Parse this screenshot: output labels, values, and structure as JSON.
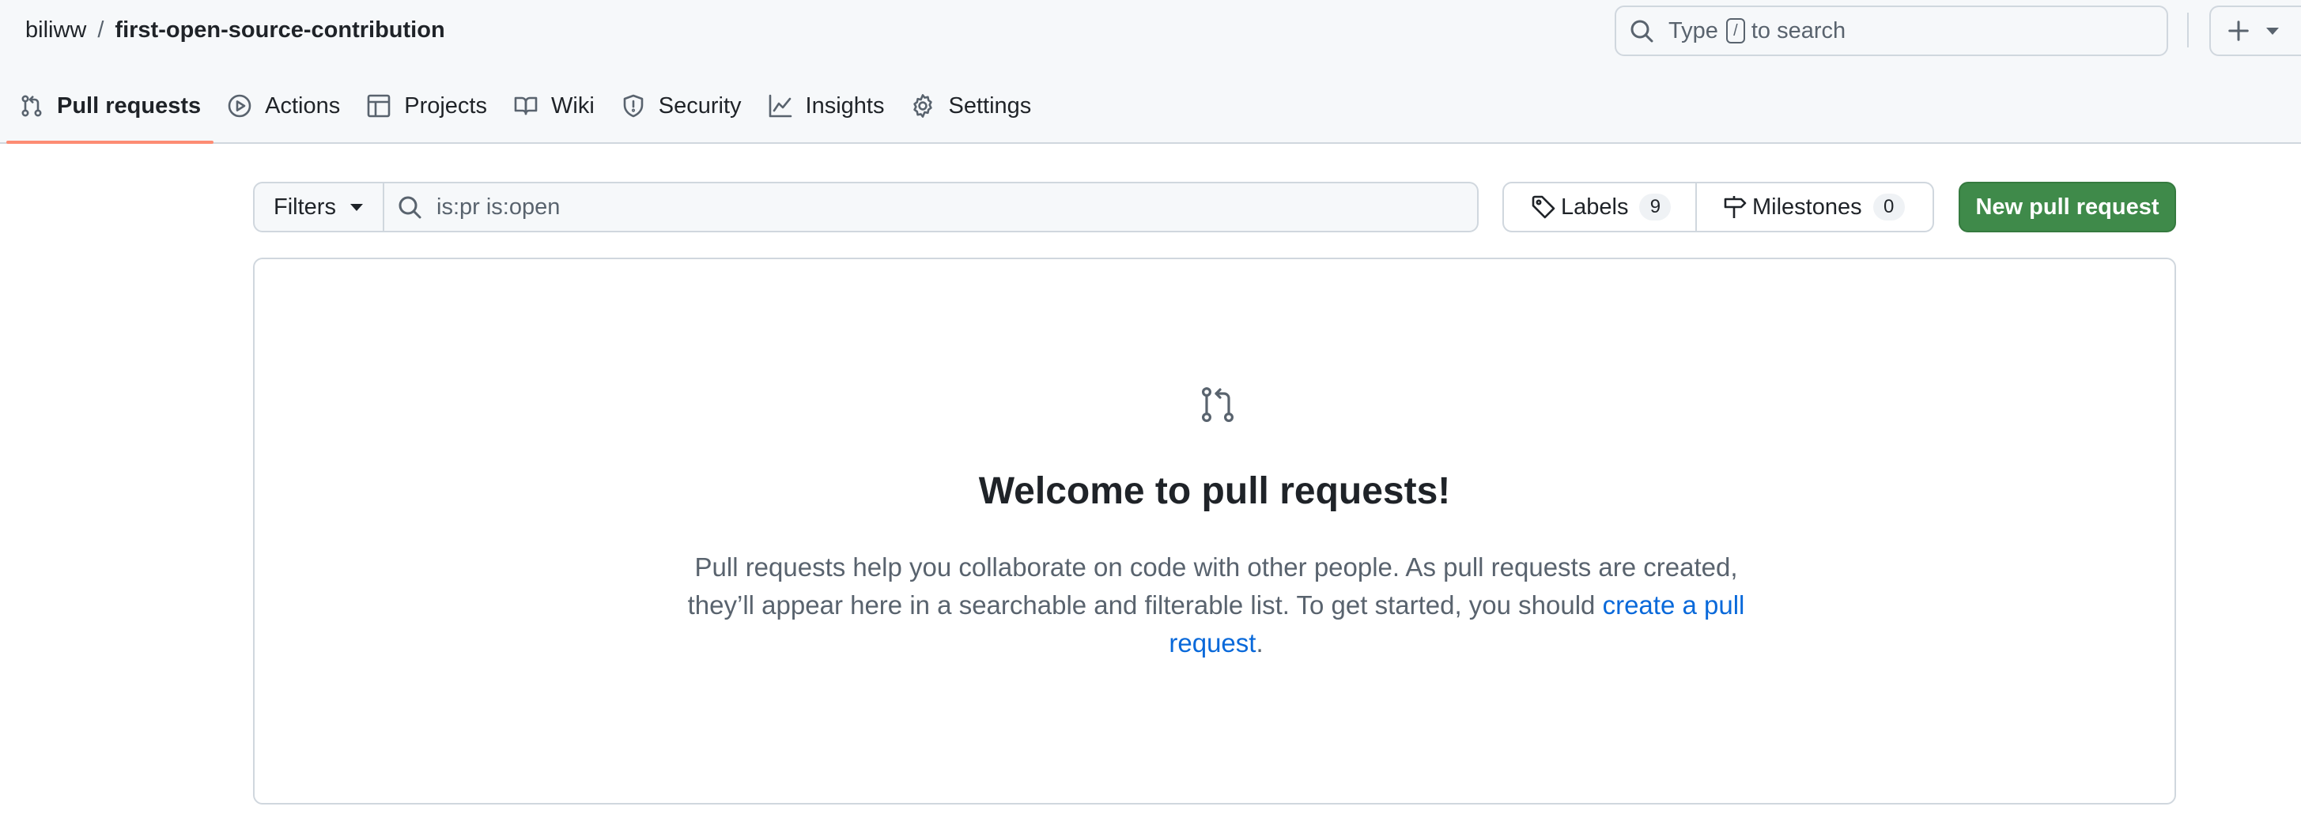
{
  "breadcrumb": {
    "owner": "biliww",
    "separator": "/",
    "repo": "first-open-source-contribution"
  },
  "search": {
    "prefix": "Type",
    "key": "/",
    "suffix": "to search"
  },
  "tabs": [
    {
      "label": "Pull requests",
      "icon": "git-pull-request-icon",
      "active": true
    },
    {
      "label": "Actions",
      "icon": "play-icon"
    },
    {
      "label": "Projects",
      "icon": "table-icon"
    },
    {
      "label": "Wiki",
      "icon": "book-icon"
    },
    {
      "label": "Security",
      "icon": "shield-icon"
    },
    {
      "label": "Insights",
      "icon": "graph-icon"
    },
    {
      "label": "Settings",
      "icon": "gear-icon"
    }
  ],
  "toolbar": {
    "filters_label": "Filters",
    "query": "is:pr is:open",
    "labels_label": "Labels",
    "labels_count": "9",
    "milestones_label": "Milestones",
    "milestones_count": "0",
    "new_pr_label": "New pull request"
  },
  "blankslate": {
    "title": "Welcome to pull requests!",
    "text_before": "Pull requests help you collaborate on code with other people. As pull requests are created, they’ll appear here in a searchable and filterable list. To get started, you should ",
    "link_text": "create a pull request",
    "text_after": "."
  },
  "colors": {
    "primary_button": "#3f8a4a",
    "active_tab_underline": "#fd8c73",
    "link": "#0969da"
  }
}
